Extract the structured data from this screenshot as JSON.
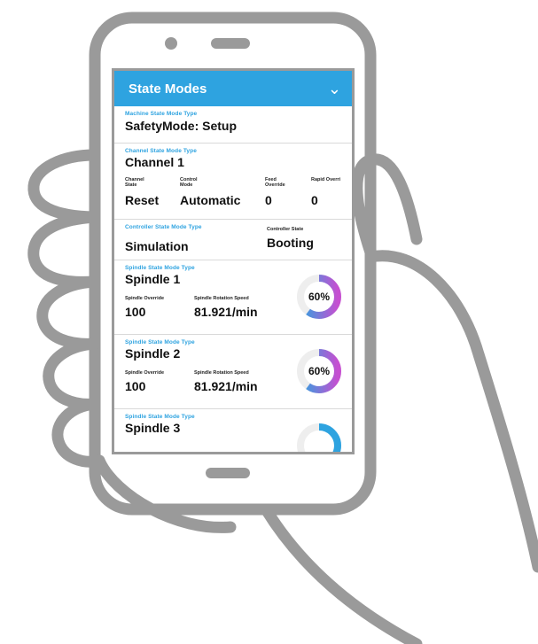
{
  "header": {
    "title": "State Modes"
  },
  "machine": {
    "label": "Machine State Mode Type",
    "value": "SafetyMode: Setup"
  },
  "channel": {
    "label": "Channel State Mode Type",
    "value": "Channel 1",
    "state_label": "Channel State",
    "state_value": "Reset",
    "control_label": "Control Mode",
    "control_value": "Automatic",
    "feed_label": "Feed Override",
    "feed_value": "0",
    "rapid_label": "Rapid Overri",
    "rapid_value": "0"
  },
  "controller": {
    "label": "Controller State Mode Type",
    "value": "Simulation",
    "state_label": "Controller State",
    "state_value": "Booting"
  },
  "spindles": [
    {
      "label": "Spindle State Mode Type",
      "name": "Spindle 1",
      "override_label": "Spindle Override",
      "override_value": "100",
      "speed_label": "Spindle Rotation Speed",
      "speed_value": "81.921/min",
      "percent_text": "60%",
      "percent": 0.6
    },
    {
      "label": "Spindle State Mode Type",
      "name": "Spindle 2",
      "override_label": "Spindle Override",
      "override_value": "100",
      "speed_label": "Spindle Rotation Speed",
      "speed_value": "81.921/min",
      "percent_text": "60%",
      "percent": 0.6
    },
    {
      "label": "Spindle State Mode Type",
      "name": "Spindle 3"
    }
  ],
  "colors": {
    "accent": "#2ea3e0",
    "gauge_start": "#2ea3e0",
    "gauge_end": "#c64fd1",
    "outline": "#9a9a9a"
  }
}
